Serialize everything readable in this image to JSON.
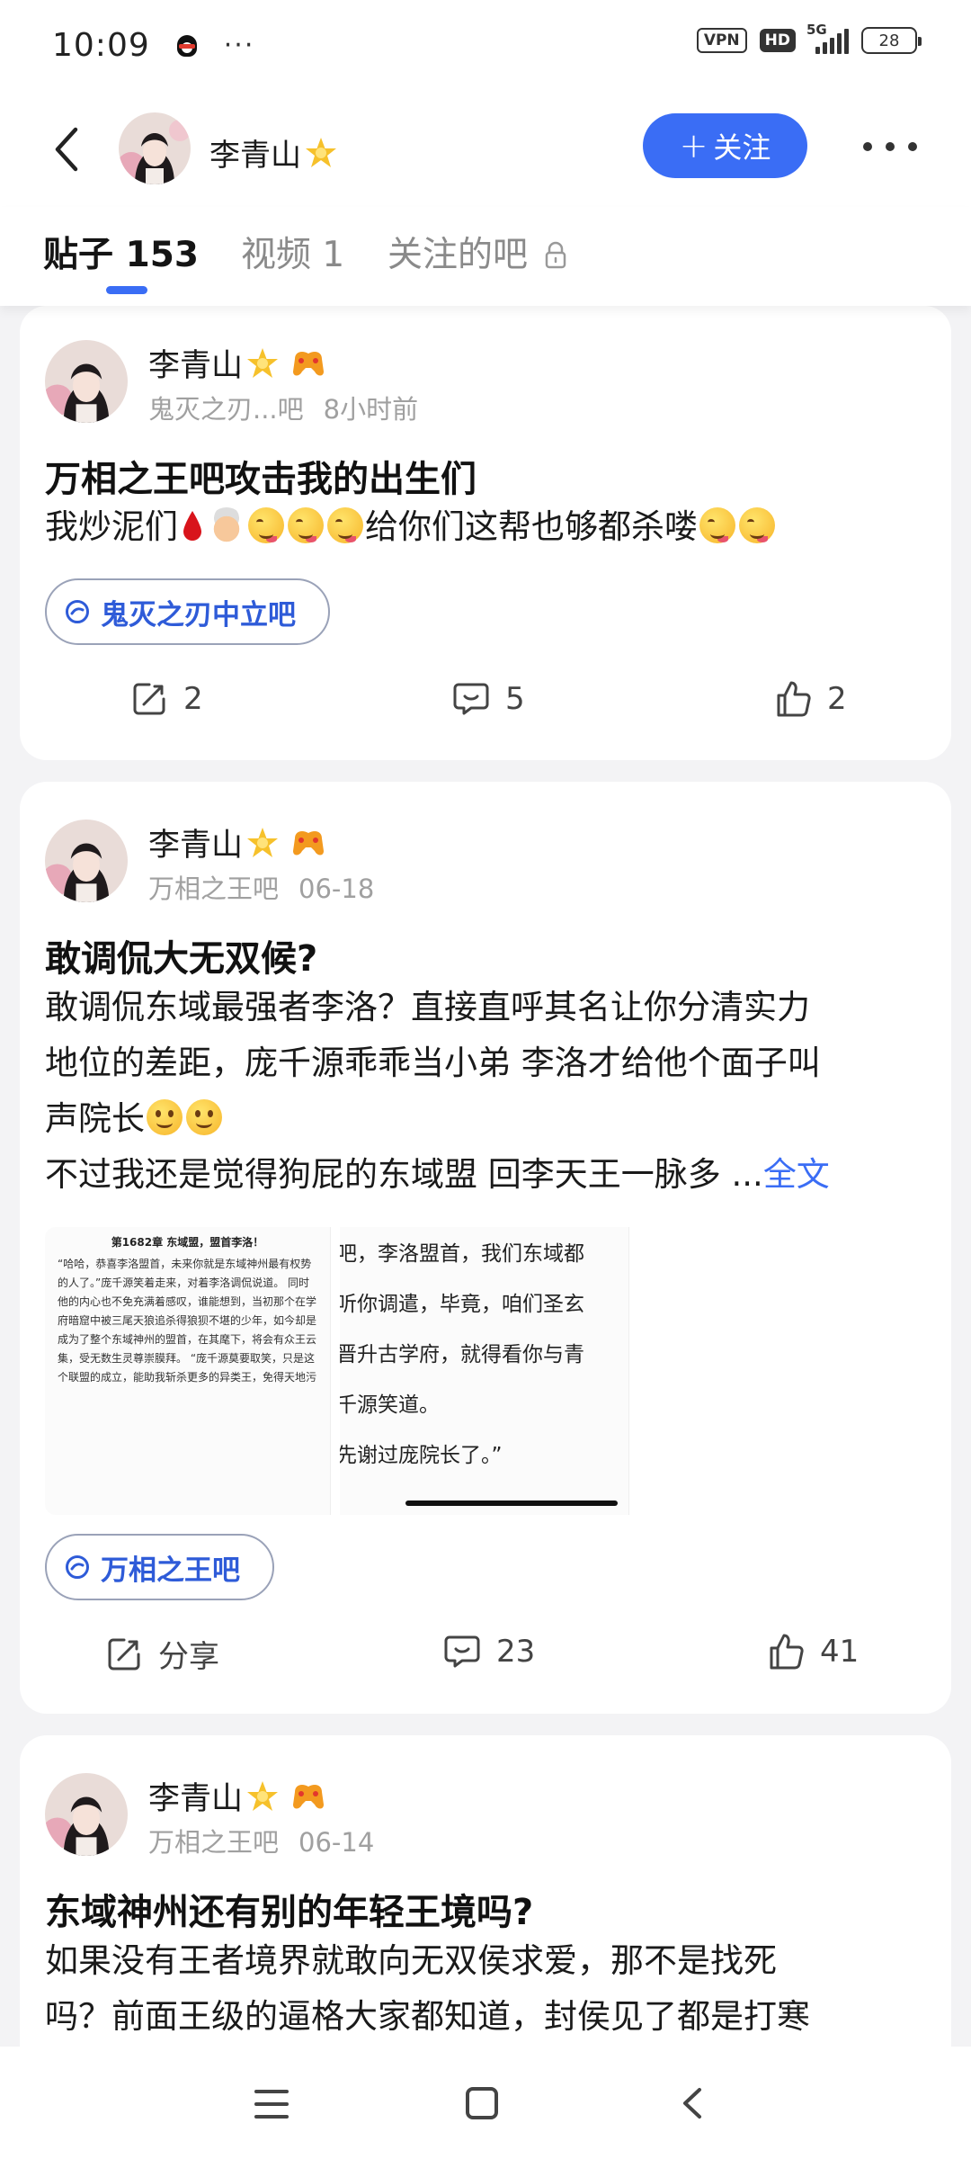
{
  "status_bar": {
    "time": "10:09",
    "dots": "···",
    "vpn": "VPN",
    "hd": "HD",
    "network": "5G",
    "battery": "28"
  },
  "header": {
    "name": "李青山",
    "follow_label": "关注"
  },
  "tabs": [
    {
      "label": "贴子 153",
      "active": true
    },
    {
      "label": "视频 1",
      "active": false
    },
    {
      "label": "关注的吧",
      "active": false
    }
  ],
  "posts": [
    {
      "author": "李青山",
      "forum_meta": "鬼灭之刃...吧",
      "time": "8小时前",
      "title": "万相之王吧攻击我的出生们",
      "body_start": "我炒泥们",
      "body_end": "给你们这帮也够都杀喽",
      "forum_tag": "鬼灭之刃中立吧",
      "share": "2",
      "comments": "5",
      "likes": "2"
    },
    {
      "author": "李青山",
      "forum_meta": "万相之王吧",
      "time": "06-18",
      "title": "敢调侃大无双候?",
      "body_lines": [
        "敢调侃东域最强者李洛？直接直呼其名让你分清实力",
        "地位的差距，庞千源乖乖当小弟 李洛才给他个面子叫",
        "声院长"
      ],
      "body_last": "不过我还是觉得狗屁的东域盟 回李天王一脉多 ...",
      "full_text_label": "全文",
      "image_left": {
        "header": "第1682章 东域盟，盟首李洛！",
        "text": "“哈哈，恭喜李洛盟首，未来你就是东域神州最有权势的人了。”庞千源笑着走来，对着李洛调侃说道。 同时他的内心也不免充满着感叹，谁能想到，当初那个在学府暗窟中被三尾天狼追杀得狼狈不堪的少年，如今却是成为了整个东域神州的盟首，在其麾下，将会有众王云集，受无数生灵尊崇膜拜。 “庞千源莫要取笑，只是这个联盟的成立，能助我斩杀更多的异类王，免得天地污"
      },
      "image_right_lines": [
        "吧，李洛盟首，我们东域都",
        "听你调遣，毕竟，咱们圣玄",
        "晋升古学府，就得看你与青",
        "千源笑道。",
        "先谢过庞院长了。”"
      ],
      "forum_tag": "万相之王吧",
      "share": "分享",
      "comments": "23",
      "likes": "41"
    },
    {
      "author": "李青山",
      "forum_meta": "万相之王吧",
      "time": "06-14",
      "title": "东域神州还有别的年轻王境吗?",
      "body_lines": [
        "如果没有王者境界就敢向无双侯求爱，那不是找死",
        "吗？前面王级的逼格大家都知道，封侯见了都是打寒"
      ]
    }
  ],
  "colors": {
    "accent": "#3a6df5",
    "background": "#f3f3f5",
    "muted_text": "#a0a0a0"
  },
  "icons": [
    "back-icon",
    "more-icon",
    "lock-icon",
    "star-icon",
    "game-controller-icon",
    "forum-tag-icon",
    "share-icon",
    "comment-icon",
    "like-icon",
    "menu-icon",
    "home-icon",
    "nav-back-icon"
  ]
}
